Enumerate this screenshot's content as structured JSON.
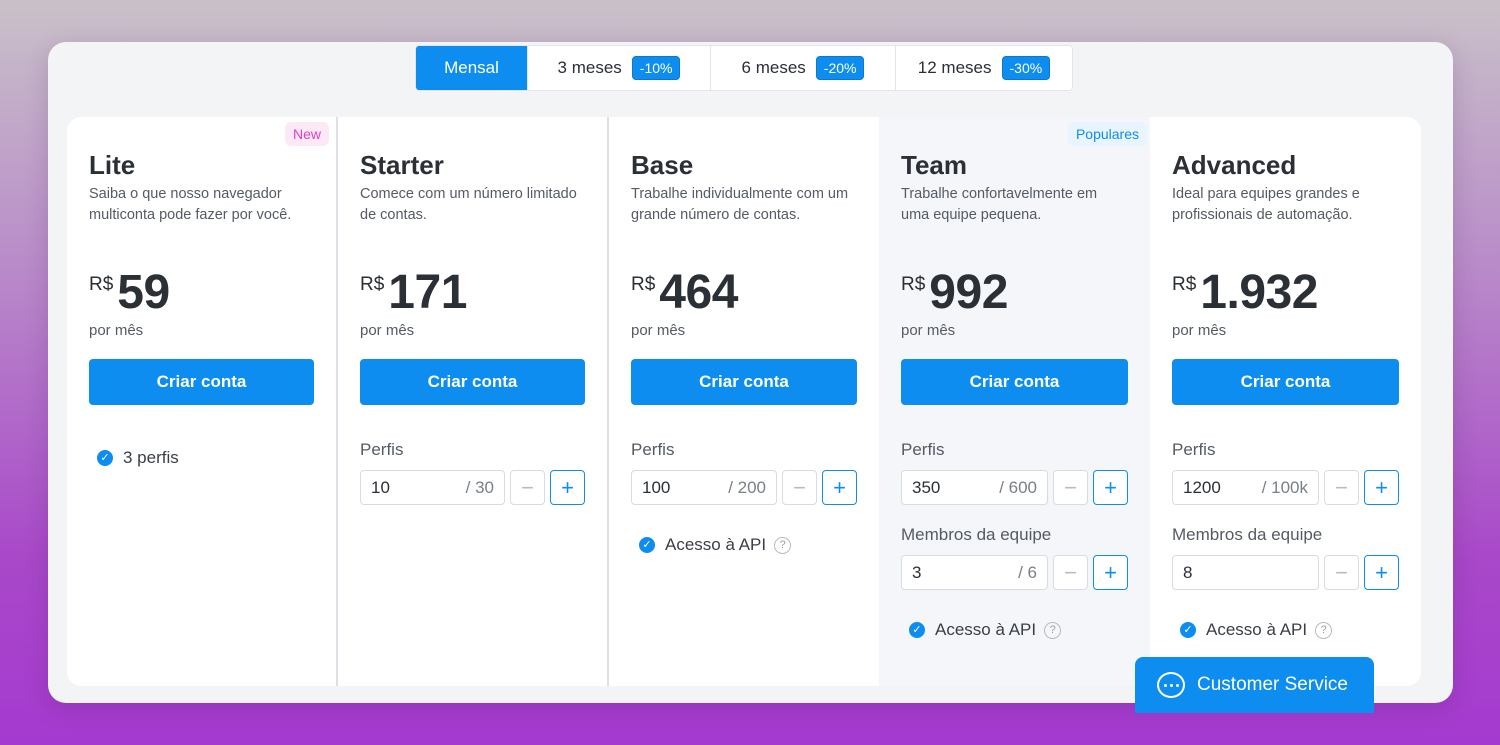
{
  "tabs": [
    {
      "label": "Mensal",
      "discount": "",
      "active": true
    },
    {
      "label": "3 meses",
      "discount": "-10%"
    },
    {
      "label": "6 meses",
      "discount": "-20%"
    },
    {
      "label": "12 meses",
      "discount": "-30%"
    }
  ],
  "plans": [
    {
      "badge": "New",
      "name": "Lite",
      "description": "Saiba o que nosso navegador multiconta pode fazer por você.",
      "currency": "R$",
      "price": "59",
      "period": "por mês",
      "cta": "Criar conta",
      "feature": "3 perfis"
    },
    {
      "name": "Starter",
      "description": "Comece com um número limitado de contas.",
      "currency": "R$",
      "price": "171",
      "period": "por mês",
      "cta": "Criar conta",
      "profiles_label": "Perfis",
      "profiles_value": "10",
      "profiles_max": "/ 30"
    },
    {
      "name": "Base",
      "description": "Trabalhe individualmente com um grande número de contas.",
      "currency": "R$",
      "price": "464",
      "period": "por mês",
      "cta": "Criar conta",
      "profiles_label": "Perfis",
      "profiles_value": "100",
      "profiles_max": "/ 200",
      "api": "Acesso à API"
    },
    {
      "badge": "Populares",
      "name": "Team",
      "description": "Trabalhe confortavelmente em uma equipe pequena.",
      "currency": "R$",
      "price": "992",
      "period": "por mês",
      "cta": "Criar conta",
      "profiles_label": "Perfis",
      "profiles_value": "350",
      "profiles_max": "/ 600",
      "members_label": "Membros da equipe",
      "members_value": "3",
      "members_max": "/ 6",
      "api": "Acesso à API"
    },
    {
      "name": "Advanced",
      "description": "Ideal para equipes grandes e profissionais de automação.",
      "currency": "R$",
      "price": "1.932",
      "period": "por mês",
      "cta": "Criar conta",
      "profiles_label": "Perfis",
      "profiles_value": "1200",
      "profiles_max": "/ 100k",
      "members_label": "Membros da equipe",
      "members_value": "8",
      "api": "Acesso à API"
    }
  ],
  "icons": {
    "minus": "−",
    "plus": "+",
    "check": "✓",
    "help": "?"
  },
  "customer_service": {
    "label": "Customer Service"
  },
  "colors": {
    "accent": "#0e8df0",
    "badge_new": "#e23fc4"
  }
}
